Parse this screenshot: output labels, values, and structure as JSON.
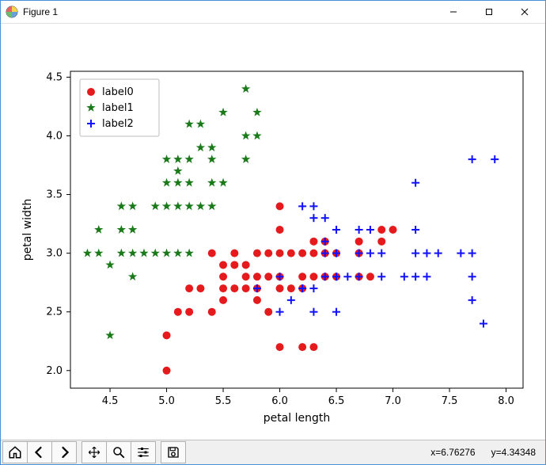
{
  "window": {
    "title": "Figure 1"
  },
  "status": {
    "coords": "x=6.76276      y=4.34348"
  },
  "toolbar": {
    "home": "Home",
    "back": "Back",
    "forward": "Forward",
    "pan": "Pan",
    "zoom": "Zoom",
    "configure": "Configure subplots",
    "save": "Save"
  },
  "chart_data": {
    "type": "scatter",
    "xlabel": "petal length",
    "ylabel": "petal width",
    "xlim": [
      4.15,
      8.15
    ],
    "ylim": [
      1.85,
      4.55
    ],
    "xticks": [
      4.5,
      5.0,
      5.5,
      6.0,
      6.5,
      7.0,
      7.5,
      8.0
    ],
    "yticks": [
      2.0,
      2.5,
      3.0,
      3.5,
      4.0,
      4.5
    ],
    "legend": {
      "loc": "upper left",
      "entries": [
        "label0",
        "label1",
        "label2"
      ]
    },
    "series": [
      {
        "name": "label0",
        "marker": "circle",
        "color": "#e41a1c",
        "points": [
          [
            5.0,
            2.0
          ],
          [
            5.0,
            2.3
          ],
          [
            5.1,
            2.5
          ],
          [
            5.2,
            2.5
          ],
          [
            5.4,
            2.5
          ],
          [
            5.5,
            2.6
          ],
          [
            5.8,
            2.6
          ],
          [
            5.9,
            2.5
          ],
          [
            5.2,
            2.7
          ],
          [
            5.3,
            2.7
          ],
          [
            5.5,
            2.7
          ],
          [
            5.6,
            2.7
          ],
          [
            5.7,
            2.7
          ],
          [
            5.8,
            2.7
          ],
          [
            6.0,
            2.7
          ],
          [
            6.1,
            2.7
          ],
          [
            6.2,
            2.7
          ],
          [
            5.5,
            2.8
          ],
          [
            5.7,
            2.8
          ],
          [
            5.8,
            2.8
          ],
          [
            5.9,
            2.8
          ],
          [
            6.0,
            2.8
          ],
          [
            6.2,
            2.8
          ],
          [
            6.3,
            2.8
          ],
          [
            6.4,
            2.8
          ],
          [
            6.5,
            2.8
          ],
          [
            6.7,
            2.8
          ],
          [
            6.8,
            2.8
          ],
          [
            5.4,
            3.0
          ],
          [
            5.6,
            3.0
          ],
          [
            5.8,
            3.0
          ],
          [
            5.9,
            3.0
          ],
          [
            6.0,
            3.0
          ],
          [
            6.1,
            3.0
          ],
          [
            6.2,
            3.0
          ],
          [
            6.3,
            3.0
          ],
          [
            6.4,
            3.0
          ],
          [
            6.5,
            3.0
          ],
          [
            6.7,
            3.0
          ],
          [
            6.0,
            3.2
          ],
          [
            6.3,
            3.1
          ],
          [
            6.4,
            3.1
          ],
          [
            7.0,
            3.2
          ],
          [
            6.9,
            3.1
          ],
          [
            6.7,
            3.1
          ],
          [
            6.0,
            3.4
          ],
          [
            6.9,
            3.2
          ],
          [
            6.0,
            2.2
          ],
          [
            6.2,
            2.2
          ],
          [
            6.3,
            2.2
          ],
          [
            5.6,
            2.9
          ],
          [
            5.5,
            2.9
          ],
          [
            5.7,
            2.9
          ]
        ]
      },
      {
        "name": "label1",
        "marker": "star",
        "color": "#1a7a1a",
        "points": [
          [
            4.3,
            3.0
          ],
          [
            4.4,
            3.0
          ],
          [
            4.5,
            2.9
          ],
          [
            4.6,
            3.0
          ],
          [
            4.7,
            3.0
          ],
          [
            4.4,
            3.2
          ],
          [
            4.6,
            3.2
          ],
          [
            4.7,
            3.2
          ],
          [
            4.8,
            3.0
          ],
          [
            4.9,
            3.0
          ],
          [
            5.0,
            3.0
          ],
          [
            5.1,
            3.0
          ],
          [
            5.2,
            3.0
          ],
          [
            4.5,
            2.3
          ],
          [
            4.7,
            2.8
          ],
          [
            4.6,
            3.4
          ],
          [
            4.7,
            3.4
          ],
          [
            4.9,
            3.4
          ],
          [
            5.0,
            3.4
          ],
          [
            5.1,
            3.4
          ],
          [
            5.2,
            3.4
          ],
          [
            5.3,
            3.4
          ],
          [
            5.4,
            3.4
          ],
          [
            5.0,
            3.6
          ],
          [
            5.1,
            3.6
          ],
          [
            5.2,
            3.6
          ],
          [
            5.4,
            3.6
          ],
          [
            5.5,
            3.6
          ],
          [
            5.1,
            3.7
          ],
          [
            5.0,
            3.8
          ],
          [
            5.1,
            3.8
          ],
          [
            5.2,
            3.8
          ],
          [
            5.4,
            3.8
          ],
          [
            5.7,
            3.8
          ],
          [
            5.3,
            3.9
          ],
          [
            5.4,
            3.9
          ],
          [
            5.7,
            4.0
          ],
          [
            5.8,
            4.0
          ],
          [
            5.2,
            4.1
          ],
          [
            5.3,
            4.1
          ],
          [
            5.5,
            4.2
          ],
          [
            5.8,
            4.2
          ],
          [
            5.7,
            4.4
          ]
        ]
      },
      {
        "name": "label2",
        "marker": "plus",
        "color": "#1111ff",
        "points": [
          [
            5.8,
            2.7
          ],
          [
            6.0,
            2.8
          ],
          [
            6.1,
            2.6
          ],
          [
            6.0,
            2.5
          ],
          [
            6.2,
            2.7
          ],
          [
            6.3,
            2.7
          ],
          [
            6.3,
            2.5
          ],
          [
            6.4,
            2.8
          ],
          [
            6.5,
            2.8
          ],
          [
            6.6,
            2.8
          ],
          [
            6.7,
            2.8
          ],
          [
            6.9,
            2.8
          ],
          [
            7.1,
            2.8
          ],
          [
            7.2,
            2.8
          ],
          [
            7.3,
            2.8
          ],
          [
            7.7,
            2.8
          ],
          [
            6.2,
            3.4
          ],
          [
            6.3,
            3.4
          ],
          [
            6.3,
            3.3
          ],
          [
            6.4,
            3.3
          ],
          [
            6.5,
            3.2
          ],
          [
            6.7,
            3.2
          ],
          [
            7.2,
            3.2
          ],
          [
            6.4,
            3.0
          ],
          [
            6.5,
            3.0
          ],
          [
            6.7,
            3.0
          ],
          [
            6.8,
            3.0
          ],
          [
            6.9,
            3.0
          ],
          [
            7.2,
            3.0
          ],
          [
            7.3,
            3.0
          ],
          [
            7.6,
            3.0
          ],
          [
            7.7,
            3.0
          ],
          [
            6.4,
            3.1
          ],
          [
            6.8,
            3.2
          ],
          [
            7.4,
            3.0
          ],
          [
            7.2,
            3.6
          ],
          [
            7.7,
            3.8
          ],
          [
            7.9,
            3.8
          ],
          [
            7.7,
            2.6
          ],
          [
            7.8,
            2.4
          ],
          [
            6.5,
            2.5
          ]
        ]
      }
    ]
  }
}
